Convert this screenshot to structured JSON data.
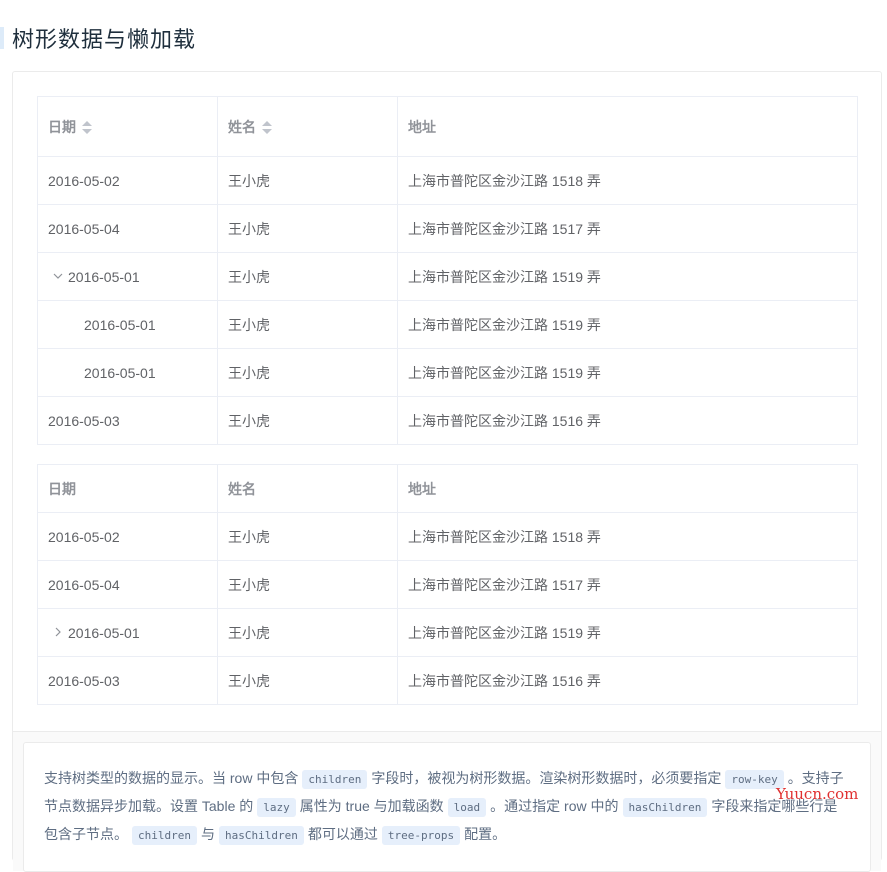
{
  "section": {
    "title": "树形数据与懒加载"
  },
  "table1": {
    "headers": {
      "date": "日期",
      "name": "姓名",
      "address": "地址"
    },
    "rows": [
      {
        "date": "2016-05-02",
        "name": "王小虎",
        "address": "上海市普陀区金沙江路 1518 弄"
      },
      {
        "date": "2016-05-04",
        "name": "王小虎",
        "address": "上海市普陀区金沙江路 1517 弄"
      },
      {
        "date": "2016-05-01",
        "name": "王小虎",
        "address": "上海市普陀区金沙江路 1519 弄",
        "expanded": true
      },
      {
        "date": "2016-05-01",
        "name": "王小虎",
        "address": "上海市普陀区金沙江路 1519 弄",
        "child": true
      },
      {
        "date": "2016-05-01",
        "name": "王小虎",
        "address": "上海市普陀区金沙江路 1519 弄",
        "child": true
      },
      {
        "date": "2016-05-03",
        "name": "王小虎",
        "address": "上海市普陀区金沙江路 1516 弄"
      }
    ]
  },
  "table2": {
    "headers": {
      "date": "日期",
      "name": "姓名",
      "address": "地址"
    },
    "rows": [
      {
        "date": "2016-05-02",
        "name": "王小虎",
        "address": "上海市普陀区金沙江路 1518 弄"
      },
      {
        "date": "2016-05-04",
        "name": "王小虎",
        "address": "上海市普陀区金沙江路 1517 弄"
      },
      {
        "date": "2016-05-01",
        "name": "王小虎",
        "address": "上海市普陀区金沙江路 1519 弄",
        "collapsed": true
      },
      {
        "date": "2016-05-03",
        "name": "王小虎",
        "address": "上海市普陀区金沙江路 1516 弄"
      }
    ]
  },
  "icons": {
    "expanded": "chevron-down-icon",
    "collapsed": "chevron-right-icon",
    "sort": "sort-caret-icon"
  },
  "description": {
    "p1": "支持树类型的数据的显示。当 row 中包含",
    "c1": "children",
    "p2": "字段时，被视为树形数据。渲染树形数据时，必须要指定",
    "c2": "row-key",
    "p3": "。支持子节点数据异步加载。设置 Table 的",
    "c3": "lazy",
    "p4": "属性为 true 与加载函数",
    "c4": "load",
    "p5": "。通过指定 row 中的",
    "c5": "hasChildren",
    "p6": "字段来指定哪些行是包含子节点。",
    "c6": "children",
    "p7": "与",
    "c7": "hasChildren",
    "p8": "都可以通过",
    "c8": "tree-props",
    "p9": "配置。"
  },
  "watermark": "Yuucn.com"
}
